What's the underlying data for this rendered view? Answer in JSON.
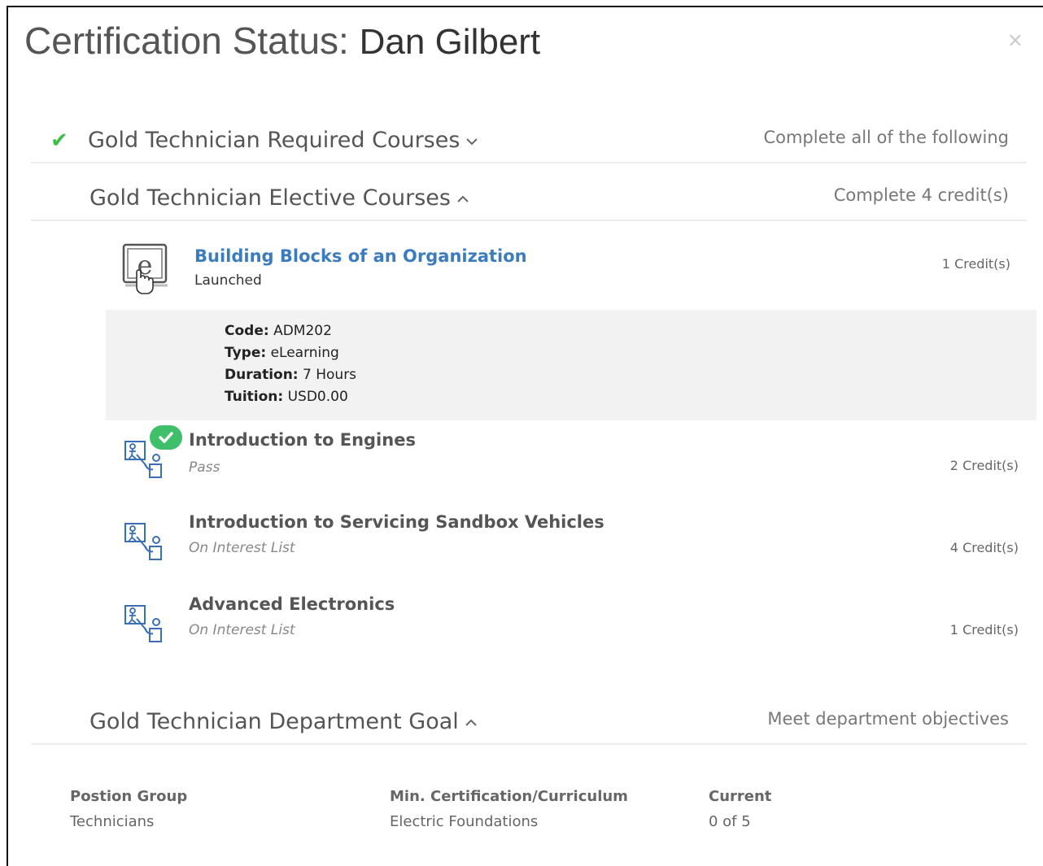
{
  "modal": {
    "title_prefix": "Certification Status: ",
    "person_name": "Dan Gilbert",
    "close_glyph": "×"
  },
  "sections": [
    {
      "title": "Gold Technician Required Courses",
      "chevron": "⌄",
      "requirement": "Complete all of the following",
      "completed": true
    },
    {
      "title": "Gold Technician Elective Courses",
      "chevron": "^",
      "requirement": "Complete 4 credit(s)",
      "completed": false
    },
    {
      "title": "Gold Technician Department Goal",
      "chevron": "^",
      "requirement": "Meet department objectives",
      "completed": false
    }
  ],
  "courses": [
    {
      "title": "Building Blocks of an Organization",
      "status": "Launched",
      "credits": "1 Credit(s)",
      "icon": "elearning-hand-icon",
      "details": {
        "code_label": "Code:",
        "code": "ADM202",
        "type_label": "Type:",
        "type": "eLearning",
        "duration_label": "Duration:",
        "duration": "7 Hours",
        "tuition_label": "Tuition:",
        "tuition": "USD0.00"
      }
    },
    {
      "title": "Introduction to Engines",
      "status": "Pass",
      "credits": "2 Credit(s)",
      "icon": "classroom-instructor-icon",
      "passed": true
    },
    {
      "title": "Introduction to Servicing Sandbox Vehicles",
      "status": "On Interest List",
      "credits": "4 Credit(s)",
      "icon": "classroom-instructor-icon"
    },
    {
      "title": "Advanced Electronics",
      "status": "On Interest List",
      "credits": "1 Credit(s)",
      "icon": "classroom-instructor-icon"
    }
  ],
  "goal_table": {
    "headers": [
      "Postion Group",
      "Min. Certification/Curriculum",
      "Current"
    ],
    "values": [
      "Technicians",
      "Electric Foundations",
      "0 of 5"
    ]
  },
  "colors": {
    "check_green": "#3fbf49",
    "link_blue": "#3a7cbd",
    "icon_blue": "#3a6fb5",
    "detail_bg": "#f2f2f2"
  }
}
